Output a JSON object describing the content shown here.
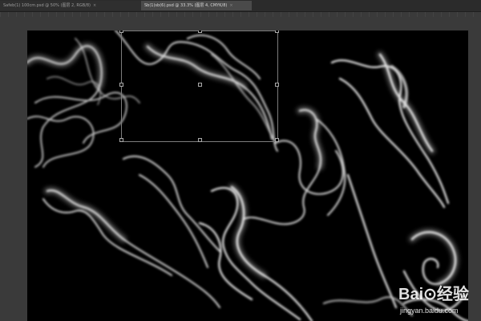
{
  "tabs": [
    {
      "label": "Safeb(1) 100cm.psd @ 50% (图层 2, RGB/8)",
      "close": "×",
      "active": false
    },
    {
      "label": "Sb(1)sb(6).psd @ 33.3% (图层 4, CMYK/8)",
      "close": "×",
      "active": true
    }
  ],
  "watermark": {
    "logo": "Bai⊙经验",
    "url": "jingyan.baidu.com"
  },
  "colors": {
    "canvas": "#000000",
    "workspace": "#3a3a3a",
    "smoke": "#e8e8e8"
  }
}
